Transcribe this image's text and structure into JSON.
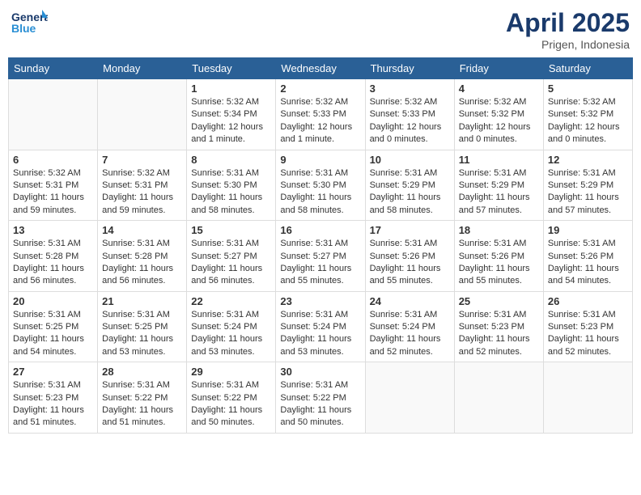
{
  "header": {
    "logo_text_general": "General",
    "logo_text_blue": "Blue",
    "month_year": "April 2025",
    "location": "Prigen, Indonesia"
  },
  "weekdays": [
    "Sunday",
    "Monday",
    "Tuesday",
    "Wednesday",
    "Thursday",
    "Friday",
    "Saturday"
  ],
  "weeks": [
    [
      {
        "day": "",
        "empty": true
      },
      {
        "day": "",
        "empty": true
      },
      {
        "day": "1",
        "sunrise": "Sunrise: 5:32 AM",
        "sunset": "Sunset: 5:34 PM",
        "daylight": "Daylight: 12 hours and 1 minute."
      },
      {
        "day": "2",
        "sunrise": "Sunrise: 5:32 AM",
        "sunset": "Sunset: 5:33 PM",
        "daylight": "Daylight: 12 hours and 1 minute."
      },
      {
        "day": "3",
        "sunrise": "Sunrise: 5:32 AM",
        "sunset": "Sunset: 5:33 PM",
        "daylight": "Daylight: 12 hours and 0 minutes."
      },
      {
        "day": "4",
        "sunrise": "Sunrise: 5:32 AM",
        "sunset": "Sunset: 5:32 PM",
        "daylight": "Daylight: 12 hours and 0 minutes."
      },
      {
        "day": "5",
        "sunrise": "Sunrise: 5:32 AM",
        "sunset": "Sunset: 5:32 PM",
        "daylight": "Daylight: 12 hours and 0 minutes."
      }
    ],
    [
      {
        "day": "6",
        "sunrise": "Sunrise: 5:32 AM",
        "sunset": "Sunset: 5:31 PM",
        "daylight": "Daylight: 11 hours and 59 minutes."
      },
      {
        "day": "7",
        "sunrise": "Sunrise: 5:32 AM",
        "sunset": "Sunset: 5:31 PM",
        "daylight": "Daylight: 11 hours and 59 minutes."
      },
      {
        "day": "8",
        "sunrise": "Sunrise: 5:31 AM",
        "sunset": "Sunset: 5:30 PM",
        "daylight": "Daylight: 11 hours and 58 minutes."
      },
      {
        "day": "9",
        "sunrise": "Sunrise: 5:31 AM",
        "sunset": "Sunset: 5:30 PM",
        "daylight": "Daylight: 11 hours and 58 minutes."
      },
      {
        "day": "10",
        "sunrise": "Sunrise: 5:31 AM",
        "sunset": "Sunset: 5:29 PM",
        "daylight": "Daylight: 11 hours and 58 minutes."
      },
      {
        "day": "11",
        "sunrise": "Sunrise: 5:31 AM",
        "sunset": "Sunset: 5:29 PM",
        "daylight": "Daylight: 11 hours and 57 minutes."
      },
      {
        "day": "12",
        "sunrise": "Sunrise: 5:31 AM",
        "sunset": "Sunset: 5:29 PM",
        "daylight": "Daylight: 11 hours and 57 minutes."
      }
    ],
    [
      {
        "day": "13",
        "sunrise": "Sunrise: 5:31 AM",
        "sunset": "Sunset: 5:28 PM",
        "daylight": "Daylight: 11 hours and 56 minutes."
      },
      {
        "day": "14",
        "sunrise": "Sunrise: 5:31 AM",
        "sunset": "Sunset: 5:28 PM",
        "daylight": "Daylight: 11 hours and 56 minutes."
      },
      {
        "day": "15",
        "sunrise": "Sunrise: 5:31 AM",
        "sunset": "Sunset: 5:27 PM",
        "daylight": "Daylight: 11 hours and 56 minutes."
      },
      {
        "day": "16",
        "sunrise": "Sunrise: 5:31 AM",
        "sunset": "Sunset: 5:27 PM",
        "daylight": "Daylight: 11 hours and 55 minutes."
      },
      {
        "day": "17",
        "sunrise": "Sunrise: 5:31 AM",
        "sunset": "Sunset: 5:26 PM",
        "daylight": "Daylight: 11 hours and 55 minutes."
      },
      {
        "day": "18",
        "sunrise": "Sunrise: 5:31 AM",
        "sunset": "Sunset: 5:26 PM",
        "daylight": "Daylight: 11 hours and 55 minutes."
      },
      {
        "day": "19",
        "sunrise": "Sunrise: 5:31 AM",
        "sunset": "Sunset: 5:26 PM",
        "daylight": "Daylight: 11 hours and 54 minutes."
      }
    ],
    [
      {
        "day": "20",
        "sunrise": "Sunrise: 5:31 AM",
        "sunset": "Sunset: 5:25 PM",
        "daylight": "Daylight: 11 hours and 54 minutes."
      },
      {
        "day": "21",
        "sunrise": "Sunrise: 5:31 AM",
        "sunset": "Sunset: 5:25 PM",
        "daylight": "Daylight: 11 hours and 53 minutes."
      },
      {
        "day": "22",
        "sunrise": "Sunrise: 5:31 AM",
        "sunset": "Sunset: 5:24 PM",
        "daylight": "Daylight: 11 hours and 53 minutes."
      },
      {
        "day": "23",
        "sunrise": "Sunrise: 5:31 AM",
        "sunset": "Sunset: 5:24 PM",
        "daylight": "Daylight: 11 hours and 53 minutes."
      },
      {
        "day": "24",
        "sunrise": "Sunrise: 5:31 AM",
        "sunset": "Sunset: 5:24 PM",
        "daylight": "Daylight: 11 hours and 52 minutes."
      },
      {
        "day": "25",
        "sunrise": "Sunrise: 5:31 AM",
        "sunset": "Sunset: 5:23 PM",
        "daylight": "Daylight: 11 hours and 52 minutes."
      },
      {
        "day": "26",
        "sunrise": "Sunrise: 5:31 AM",
        "sunset": "Sunset: 5:23 PM",
        "daylight": "Daylight: 11 hours and 52 minutes."
      }
    ],
    [
      {
        "day": "27",
        "sunrise": "Sunrise: 5:31 AM",
        "sunset": "Sunset: 5:23 PM",
        "daylight": "Daylight: 11 hours and 51 minutes."
      },
      {
        "day": "28",
        "sunrise": "Sunrise: 5:31 AM",
        "sunset": "Sunset: 5:22 PM",
        "daylight": "Daylight: 11 hours and 51 minutes."
      },
      {
        "day": "29",
        "sunrise": "Sunrise: 5:31 AM",
        "sunset": "Sunset: 5:22 PM",
        "daylight": "Daylight: 11 hours and 50 minutes."
      },
      {
        "day": "30",
        "sunrise": "Sunrise: 5:31 AM",
        "sunset": "Sunset: 5:22 PM",
        "daylight": "Daylight: 11 hours and 50 minutes."
      },
      {
        "day": "",
        "empty": true
      },
      {
        "day": "",
        "empty": true
      },
      {
        "day": "",
        "empty": true
      }
    ]
  ]
}
